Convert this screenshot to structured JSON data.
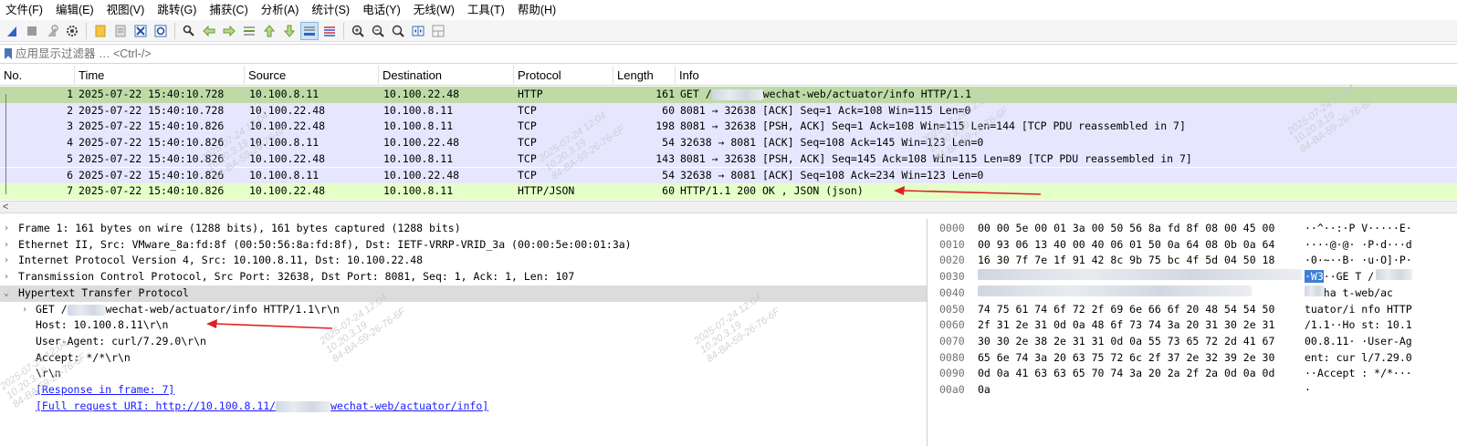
{
  "menu": [
    "文件(F)",
    "编辑(E)",
    "视图(V)",
    "跳转(G)",
    "捕获(C)",
    "分析(A)",
    "统计(S)",
    "电话(Y)",
    "无线(W)",
    "工具(T)",
    "帮助(H)"
  ],
  "toolbar_icons": [
    "shark-fin-start-icon",
    "stop-icon",
    "restart-icon",
    "options-gear-icon",
    "open-file-icon",
    "save-file-icon",
    "close-file-icon",
    "reload-icon",
    "find-icon",
    "back-icon",
    "forward-icon",
    "goto-packet-icon",
    "first-packet-icon",
    "last-packet-icon",
    "autoscroll-icon",
    "colorize-icon",
    "zoom-in-icon",
    "zoom-out-icon",
    "normal-size-icon",
    "resize-columns-icon",
    "layout-icon"
  ],
  "filter": {
    "placeholder": "应用显示过滤器 … <Ctrl-/>",
    "value": ""
  },
  "columns": [
    "No.",
    "Time",
    "Source",
    "Destination",
    "Protocol",
    "Length",
    "Info"
  ],
  "packets": [
    {
      "no": "1",
      "time": "2025-07-22 15:40:10.728",
      "src": "10.100.8.11",
      "dst": "10.100.22.48",
      "proto": "HTTP",
      "len": "161",
      "info_pre": "GET /",
      "info_post": "wechat-web/actuator/info HTTP/1.1",
      "style": "sel"
    },
    {
      "no": "2",
      "time": "2025-07-22 15:40:10.728",
      "src": "10.100.22.48",
      "dst": "10.100.8.11",
      "proto": "TCP",
      "len": "60",
      "info": "8081 → 32638 [ACK] Seq=1 Ack=108 Win=115 Len=0",
      "style": "tcp"
    },
    {
      "no": "3",
      "time": "2025-07-22 15:40:10.826",
      "src": "10.100.22.48",
      "dst": "10.100.8.11",
      "proto": "TCP",
      "len": "198",
      "info": "8081 → 32638 [PSH, ACK] Seq=1 Ack=108 Win=115 Len=144 [TCP PDU reassembled in 7]",
      "style": "tcp"
    },
    {
      "no": "4",
      "time": "2025-07-22 15:40:10.826",
      "src": "10.100.8.11",
      "dst": "10.100.22.48",
      "proto": "TCP",
      "len": "54",
      "info": "32638 → 8081 [ACK] Seq=108 Ack=145 Win=123 Len=0",
      "style": "tcp"
    },
    {
      "no": "5",
      "time": "2025-07-22 15:40:10.826",
      "src": "10.100.22.48",
      "dst": "10.100.8.11",
      "proto": "TCP",
      "len": "143",
      "info": "8081 → 32638 [PSH, ACK] Seq=145 Ack=108 Win=115 Len=89 [TCP PDU reassembled in 7]",
      "style": "tcp"
    },
    {
      "no": "6",
      "time": "2025-07-22 15:40:10.826",
      "src": "10.100.8.11",
      "dst": "10.100.22.48",
      "proto": "TCP",
      "len": "54",
      "info": "32638 → 8081 [ACK] Seq=108 Ack=234 Win=123 Len=0",
      "style": "tcp"
    },
    {
      "no": "7",
      "time": "2025-07-22 15:40:10.826",
      "src": "10.100.22.48",
      "dst": "10.100.8.11",
      "proto": "HTTP/JSON",
      "len": "60",
      "info": "HTTP/1.1 200 OK , JSON (json)",
      "style": "http"
    }
  ],
  "scroll_left_arrow": "<",
  "details": {
    "frame": "Frame 1: 161 bytes on wire (1288 bits), 161 bytes captured (1288 bits)",
    "ethernet": "Ethernet II, Src: VMware_8a:fd:8f (00:50:56:8a:fd:8f), Dst: IETF-VRRP-VRID_3a (00:00:5e:00:01:3a)",
    "ip": "Internet Protocol Version 4, Src: 10.100.8.11, Dst: 10.100.22.48",
    "tcp": "Transmission Control Protocol, Src Port: 32638, Dst Port: 8081, Seq: 1, Ack: 1, Len: 107",
    "http": "Hypertext Transfer Protocol",
    "get_pre": "GET /",
    "get_post": "wechat-web/actuator/info HTTP/1.1\\r\\n",
    "host": "Host: 10.100.8.11\\r\\n",
    "ua": "User-Agent: curl/7.29.0\\r\\n",
    "accept": "Accept: */*\\r\\n",
    "crlf": "\\r\\n",
    "response_link": "[Response in frame: 7]",
    "uri_pre": "[Full request URI: http://10.100.8.11/",
    "uri_post": "wechat-web/actuator/info]"
  },
  "bytes": [
    {
      "off": "0000",
      "hex": "00 00 5e 00 01 3a 00 50  56 8a fd 8f 08 00 45 00",
      "ascii": "··^··:·P V·····E·"
    },
    {
      "off": "0010",
      "hex": "00 93 06 13 40 00 40 06  01 50 0a 64 08 0b 0a 64",
      "ascii": "····@·@· ·P·d···d"
    },
    {
      "off": "0020",
      "hex": "16 30 7f 7e 1f 91 42 8c  9b 75 bc 4f 5d 04 50 18",
      "ascii": "·0·~··B· ·u·O]·P·"
    },
    {
      "off": "0030",
      "hex": "",
      "ascii_hl": "·W3",
      "ascii_rest": "··GE T /",
      "blur": true
    },
    {
      "off": "0040",
      "hex_tail": "63",
      "ascii_pre": "",
      "ascii_post": "wecha t-web/ac",
      "blur": true
    },
    {
      "off": "0050",
      "hex": "74 75 61 74 6f 72 2f 69  6e 66 6f 20 48 54 54 50",
      "ascii": "tuator/i nfo HTTP"
    },
    {
      "off": "0060",
      "hex": "2f 31 2e 31 0d 0a 48 6f  73 74 3a 20 31 30 2e 31",
      "ascii": "/1.1··Ho st: 10.1"
    },
    {
      "off": "0070",
      "hex": "30 30 2e 38 2e 31 31 0d  0a 55 73 65 72 2d 41 67",
      "ascii": "00.8.11· ·User-Ag"
    },
    {
      "off": "0080",
      "hex": "65 6e 74 3a 20 63 75 72  6c 2f 37 2e 32 39 2e 30",
      "ascii": "ent: cur l/7.29.0"
    },
    {
      "off": "0090",
      "hex": "0d 0a 41 63 63 65 70 74  3a 20 2a 2f 2a 0d 0a 0d",
      "ascii": "··Accept : */*···"
    },
    {
      "off": "00a0",
      "hex": "0a",
      "ascii": "·"
    }
  ],
  "watermark": "2025-07-24 12:04\n10.20.3.19\n84-BA-59-26-76-6F",
  "colors": {
    "http_row": "#e4ffc7",
    "tcp_row": "#e7e6ff",
    "selected_row": "#bedba7",
    "link": "#1a1aff",
    "annotation_arrow": "#e02020"
  }
}
